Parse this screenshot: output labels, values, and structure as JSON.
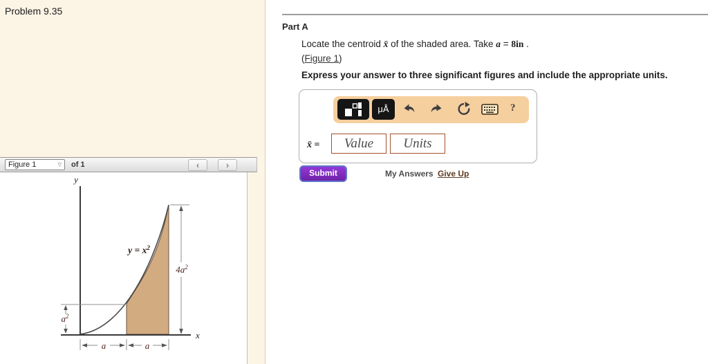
{
  "window": {
    "title": "Problem 9.35"
  },
  "figure_panel": {
    "selector_label": "Figure 1",
    "selector_caret": "▽",
    "of_label": "of 1",
    "prev_label": "‹",
    "next_label": "›",
    "figure": {
      "y_axis_label": "y",
      "x_axis_label": "x",
      "curve_label_base": "y = x",
      "curve_label_sup": "2",
      "dim_height_base": "4a",
      "dim_height_sup": "2",
      "dim_small_base": "a",
      "dim_small_sup": "2",
      "dim_bottom_left": "a",
      "dim_bottom_right": "a"
    }
  },
  "part_a": {
    "heading": "Part A",
    "statement": [
      {
        "text": "Locate the centroid "
      },
      {
        "text": "x̄"
      },
      {
        "text": " of the shaded area. Take "
      },
      {
        "text": "a"
      },
      {
        "text": " = "
      },
      {
        "text": "8in"
      },
      {
        "text": " ."
      }
    ],
    "figure_ref_open": "(",
    "figure_ref_link": "Figure 1",
    "figure_ref_close": ")",
    "instruction": "Express your answer to three significant figures and include the appropriate units.",
    "answer": {
      "variable": "x̄",
      "equals": " =",
      "value_placeholder": "Value",
      "units_placeholder": "Units",
      "toolbar": {
        "units_button_label": "μÅ",
        "help_label": "?"
      }
    },
    "submit_label": "Submit",
    "my_answers_label": "My Answers",
    "give_up_label": "Give Up"
  },
  "colors": {
    "left_panel_bg": "#fcf5e6",
    "toolbar_bg": "#f6cf9f",
    "submit_purple": "#7d2fbd",
    "shaded_area_tan": "#d2ab80",
    "answer_input_border": "#a3502a",
    "give_up_link": "#5e3a20"
  }
}
